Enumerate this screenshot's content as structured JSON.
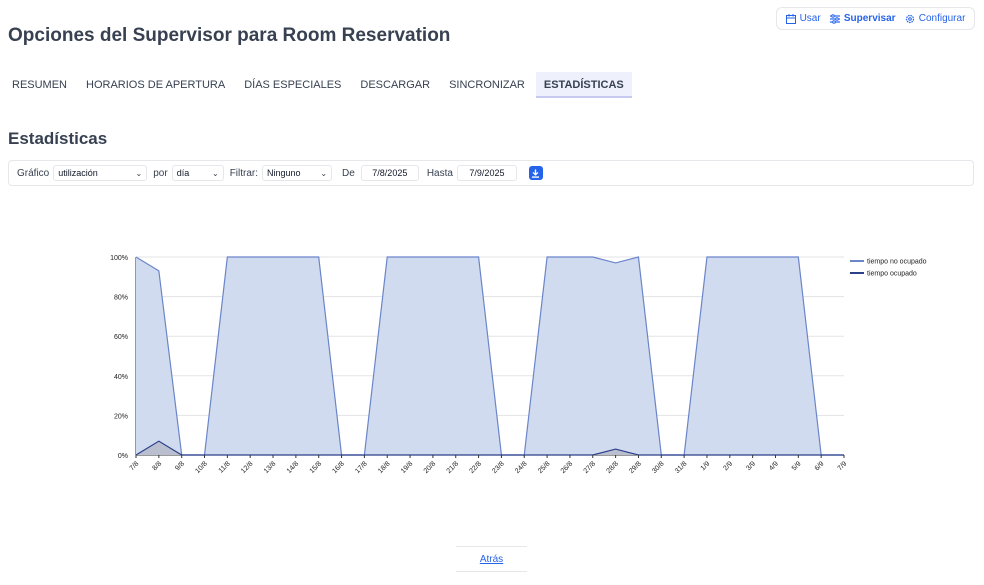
{
  "topnav": {
    "items": [
      {
        "label": "Usar",
        "icon": "calendar-icon"
      },
      {
        "label": "Supervisar",
        "icon": "sliders-icon"
      },
      {
        "label": "Configurar",
        "icon": "gear-icon"
      }
    ]
  },
  "page": {
    "title": "Opciones del Supervisor para Room Reservation",
    "section_title": "Estadísticas"
  },
  "tabs": [
    "RESUMEN",
    "HORARIOS DE APERTURA",
    "DÍAS ESPECIALES",
    "DESCARGAR",
    "SINCRONIZAR",
    "ESTADÍSTICAS"
  ],
  "active_tab": "ESTADÍSTICAS",
  "filters": {
    "grafico_label": "Gráfico",
    "grafico_value": "utilización",
    "por_label": "por",
    "por_value": "día",
    "filtrar_label": "Filtrar:",
    "filtrar_value": "Ninguno",
    "de_label": "De",
    "de_value": "7/8/2025",
    "hasta_label": "Hasta",
    "hasta_value": "7/9/2025",
    "download_icon": "download-icon"
  },
  "colors": {
    "accent": "#2563eb",
    "area_fill": "#d1dbf0",
    "free_line": "#6b85c9",
    "busy_line": "#2b3f8a",
    "busy_fill": "#b9bfcf"
  },
  "chart_data": {
    "type": "area",
    "x": [
      "7/8",
      "8/8",
      "9/8",
      "10/8",
      "11/8",
      "12/8",
      "13/8",
      "14/8",
      "15/8",
      "16/8",
      "17/8",
      "18/8",
      "19/8",
      "20/8",
      "21/8",
      "22/8",
      "23/8",
      "24/8",
      "25/8",
      "26/8",
      "27/8",
      "28/8",
      "29/8",
      "30/8",
      "31/8",
      "1/9",
      "2/9",
      "3/9",
      "4/9",
      "5/9",
      "6/9",
      "7/9"
    ],
    "yticks": [
      "0%",
      "20%",
      "40%",
      "60%",
      "80%",
      "100%"
    ],
    "ylim": [
      0,
      100
    ],
    "series": [
      {
        "name": "tiempo no ocupado",
        "values": [
          100,
          93,
          0,
          0,
          100,
          100,
          100,
          100,
          100,
          0,
          0,
          100,
          100,
          100,
          100,
          100,
          0,
          0,
          100,
          100,
          100,
          97,
          100,
          0,
          0,
          100,
          100,
          100,
          100,
          100,
          0,
          0
        ]
      },
      {
        "name": "tiempo ocupado",
        "values": [
          0,
          7,
          0,
          0,
          0,
          0,
          0,
          0,
          0,
          0,
          0,
          0,
          0,
          0,
          0,
          0,
          0,
          0,
          0,
          0,
          0,
          3,
          0,
          0,
          0,
          0,
          0,
          0,
          0,
          0,
          0,
          0
        ]
      }
    ],
    "legend_position": "top-right",
    "grid": true
  },
  "footer": {
    "back_label": "Atrás"
  }
}
